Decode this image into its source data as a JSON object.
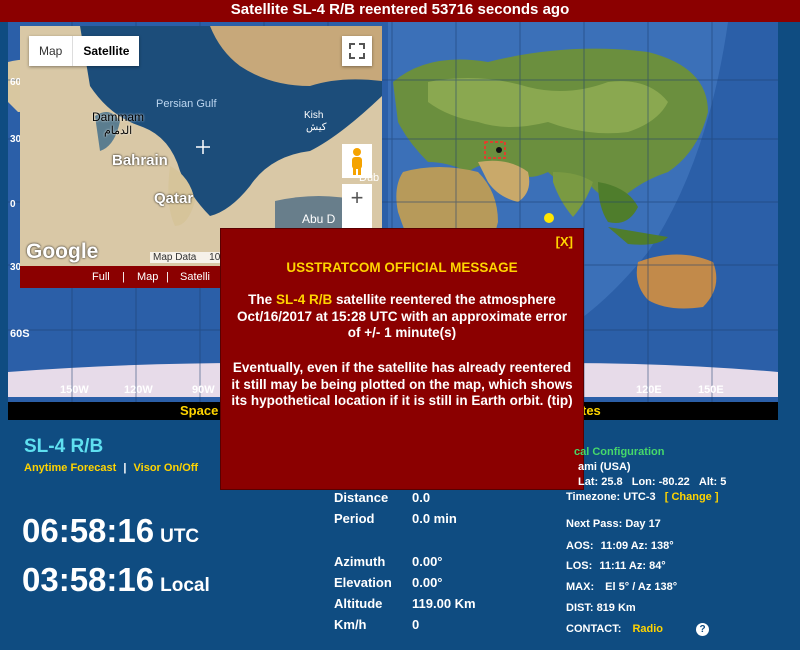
{
  "header": {
    "title": "Satellite SL-4 R/B reentered 53716 seconds ago"
  },
  "world_map": {
    "lat_labels": [
      "60",
      "30",
      "0",
      "30S",
      "60S"
    ],
    "lon_labels": [
      "150W",
      "120W",
      "90W",
      "120E",
      "150E"
    ],
    "bottom_bar_left": "Space",
    "bottom_bar_right": "tes"
  },
  "inset_map": {
    "tab_map": "Map",
    "tab_satellite": "Satellite",
    "labels": {
      "persian_gulf": "Persian Gulf",
      "dammam": "Dammam",
      "dammam_ar": "الدمام",
      "bahrain": "Bahrain",
      "qatar": "Qatar",
      "kish": "Kish",
      "kish_fa": "کیش",
      "dubai": "Dub",
      "abu_dhabi": "Abu D"
    },
    "google": "Google",
    "map_data": "Map Data",
    "map_data_2": "10",
    "links": {
      "full": "Full",
      "map": "Map",
      "satellite": "Satelli"
    }
  },
  "popup": {
    "close": "[X]",
    "title": "USSTRATCOM OFFICIAL MESSAGE",
    "p1_pre": "The",
    "p1_sat": "SL-4 R/B",
    "p1_post": "satellite reentered the atmosphere Oct/16/2017 at 15:28 UTC with an approximate error of +/- 1 minute(s)",
    "p2": "Eventually, even if the satellite has already reentered it still may be being plotted on the map, which shows its hypothetical location if it is still in Earth orbit. (tip)"
  },
  "satellite": {
    "name": "SL-4 R/B",
    "link_forecast": "Anytime Forecast",
    "separator": "|",
    "link_visor": "Visor On/Off"
  },
  "clock": {
    "utc_time": "06:58:16",
    "utc_label": "UTC",
    "local_time": "03:58:16",
    "local_label": "Local"
  },
  "stats": {
    "distance_label": "Distance",
    "distance_value": "0.0",
    "period_label": "Period",
    "period_value": "0.0 min",
    "azimuth_label": "Azimuth",
    "azimuth_value": "0.00°",
    "elevation_label": "Elevation",
    "elevation_value": "0.00°",
    "altitude_label": "Altitude",
    "altitude_value": "119.00 Km",
    "kmh_label": "Km/h",
    "kmh_value": "0"
  },
  "location": {
    "config_label": "cal Configuration",
    "city": "ami (USA)",
    "lat_label": "Lat:",
    "lat_value": "25.8",
    "lon_label": "Lon:",
    "lon_value": "-80.22",
    "alt_label": "Alt:",
    "alt_value": "5",
    "tz_label": "Timezone:",
    "tz_value": "UTC-3",
    "change_label": "[ Change ]",
    "next_pass_label": "Next Pass:",
    "next_pass_value": "Day  17",
    "aos_label": "AOS:",
    "aos_value": "11:09  Az: 138°",
    "los_label": "LOS:",
    "los_value": "11:11  Az: 84°",
    "max_label": "MAX:",
    "max_value": "El 5° / Az 138°",
    "dist_label": "DIST:",
    "dist_value": "819 Km",
    "contact_label": "CONTACT:",
    "contact_value": "Radio",
    "help_icon": "?"
  },
  "colors": {
    "accent_red": "#8b0000",
    "page_blue": "#0f4c81",
    "highlight_yellow": "#ffd400",
    "cyan": "#5fe0f0"
  }
}
